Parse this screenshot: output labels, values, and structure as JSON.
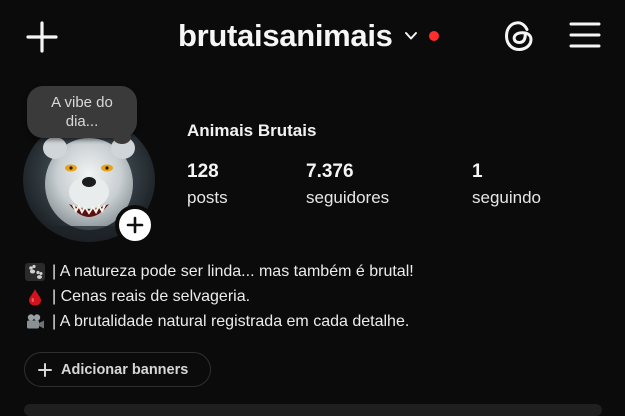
{
  "header": {
    "username": "brutaisanimais",
    "has_notification_dot": true,
    "notification_color": "#ff2d2d",
    "icons": [
      "plus-icon",
      "chevron-down-icon",
      "threads-icon",
      "hamburger-menu-icon"
    ]
  },
  "profile": {
    "note": "A vibe do dia...",
    "display_name": "Animais Brutais",
    "stats": [
      {
        "value": "128",
        "label": "posts"
      },
      {
        "value": "7.376",
        "label": "seguidores"
      },
      {
        "value": "1",
        "label": "seguindo"
      }
    ]
  },
  "bio": [
    {
      "emoji": "paw-prints-icon",
      "text": "| A natureza pode ser linda... mas também é brutal!"
    },
    {
      "emoji": "blood-drop-icon",
      "text": "| Cenas reais de selvageria."
    },
    {
      "emoji": "video-camera-icon",
      "text": "| A brutalidade natural registrada em cada detalhe."
    }
  ],
  "banner_button": {
    "label": "Adicionar banners"
  },
  "colors": {
    "background": "#0b0b0b",
    "text": "#f5f5f5",
    "accent_red": "#ff2d2d"
  }
}
